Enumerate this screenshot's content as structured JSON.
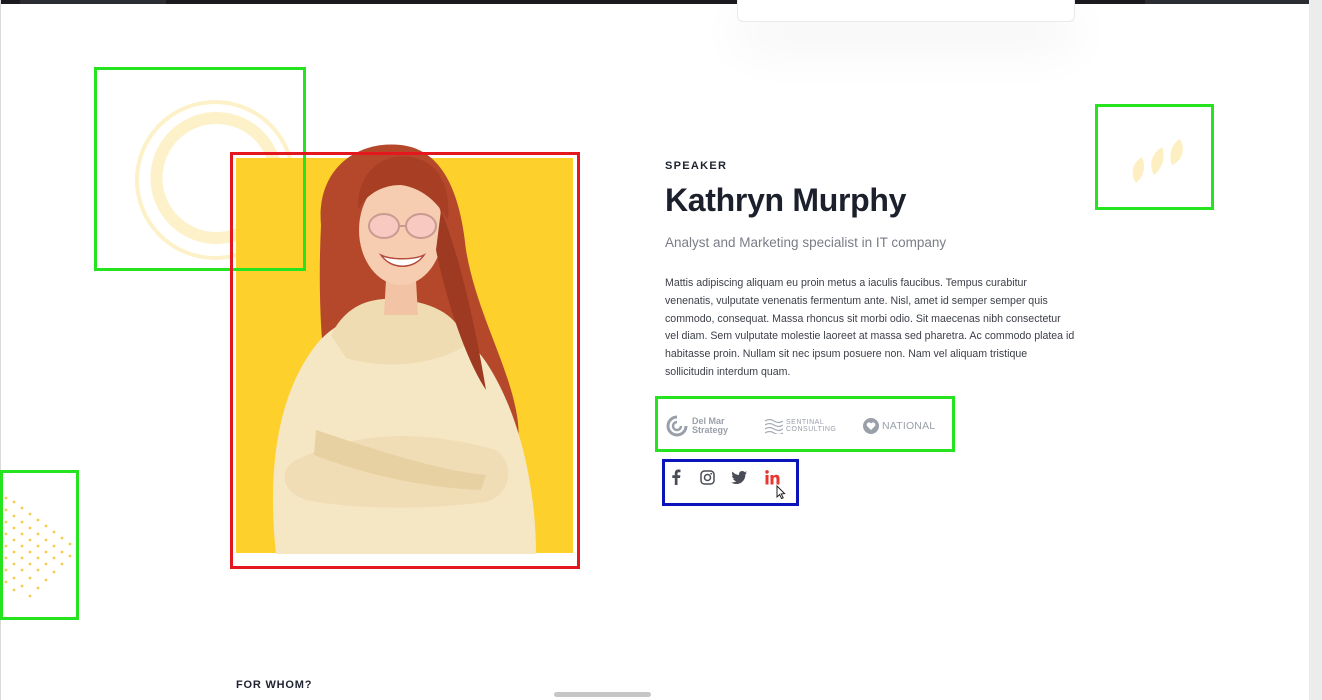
{
  "speaker": {
    "eyebrow": "SPEAKER",
    "name": "Kathryn Murphy",
    "role": "Analyst and Marketing specialist in IT company",
    "bio": "Mattis adipiscing aliquam eu proin metus a iaculis faucibus. Tempus curabitur venenatis, vulputate venenatis fermentum ante. Nisl, amet id semper semper quis commodo, consequat. Massa rhoncus sit morbi odio. Sit maecenas nibh consectetur vel diam. Sem vulputate molestie laoreet at massa sed pharetra. Ac commodo platea id habitasse proin. Nullam sit nec ipsum posuere non. Nam vel aliquam tristique sollicitudin interdum quam."
  },
  "logos": [
    {
      "name": "Del Mar Strategy",
      "line1": "Del Mar",
      "line2": "Strategy",
      "icon": "wave-swirl-icon"
    },
    {
      "name": "Sentinal Consulting",
      "line1": "SENTINAL",
      "line2": "CONSULTING",
      "icon": "waves-icon"
    },
    {
      "name": "National",
      "line1": "NATIONAL",
      "icon": "heart-badge-icon"
    }
  ],
  "social": [
    {
      "name": "facebook",
      "icon": "facebook-icon"
    },
    {
      "name": "instagram",
      "icon": "instagram-icon"
    },
    {
      "name": "twitter",
      "icon": "twitter-icon"
    },
    {
      "name": "linkedin",
      "icon": "linkedin-icon",
      "state": "hover"
    }
  ],
  "next_section": {
    "label": "FOR WHOM?"
  },
  "colors": {
    "accent_yellow": "#fdd02b",
    "linkedin_hover": "#e5372f",
    "heading": "#1c1f2c",
    "muted": "#7a7d87",
    "annotation_green": "#25e31f",
    "annotation_red": "#e4161e",
    "annotation_blue": "#0a14b8"
  }
}
